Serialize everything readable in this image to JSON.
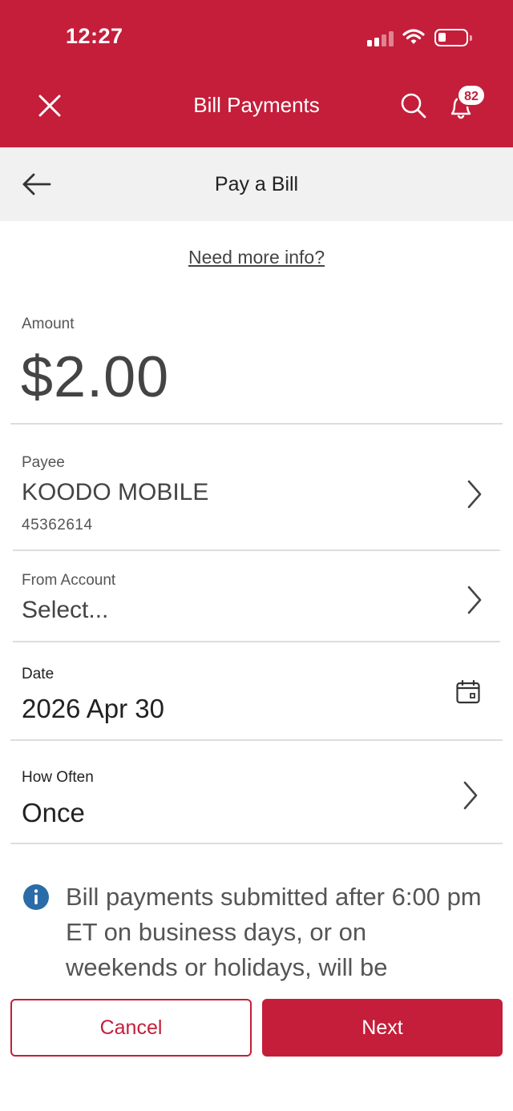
{
  "status_bar": {
    "time": "12:27"
  },
  "header": {
    "title": "Bill Payments",
    "notification_count": "82",
    "icons": [
      "close-icon",
      "search-icon",
      "bell-icon"
    ],
    "color": "#c41e3a"
  },
  "subheader": {
    "title": "Pay a Bill",
    "icon": "arrow-left-icon"
  },
  "info_link": "Need more info?",
  "form": {
    "amount": {
      "label": "Amount",
      "value": "$2.00"
    },
    "payee": {
      "label": "Payee",
      "value": "KOODO MOBILE",
      "account_number": "45362614"
    },
    "from_account": {
      "label": "From Account",
      "value": "Select..."
    },
    "date": {
      "label": "Date",
      "value": "2026 Apr 30"
    },
    "how_often": {
      "label": "How Often",
      "value": "Once"
    }
  },
  "notice": {
    "icon": "info-icon",
    "text": "Bill payments submitted after 6:00 pm ET on business days, or on weekends or holidays, will be"
  },
  "actions": {
    "cancel_label": "Cancel",
    "next_label": "Next"
  }
}
